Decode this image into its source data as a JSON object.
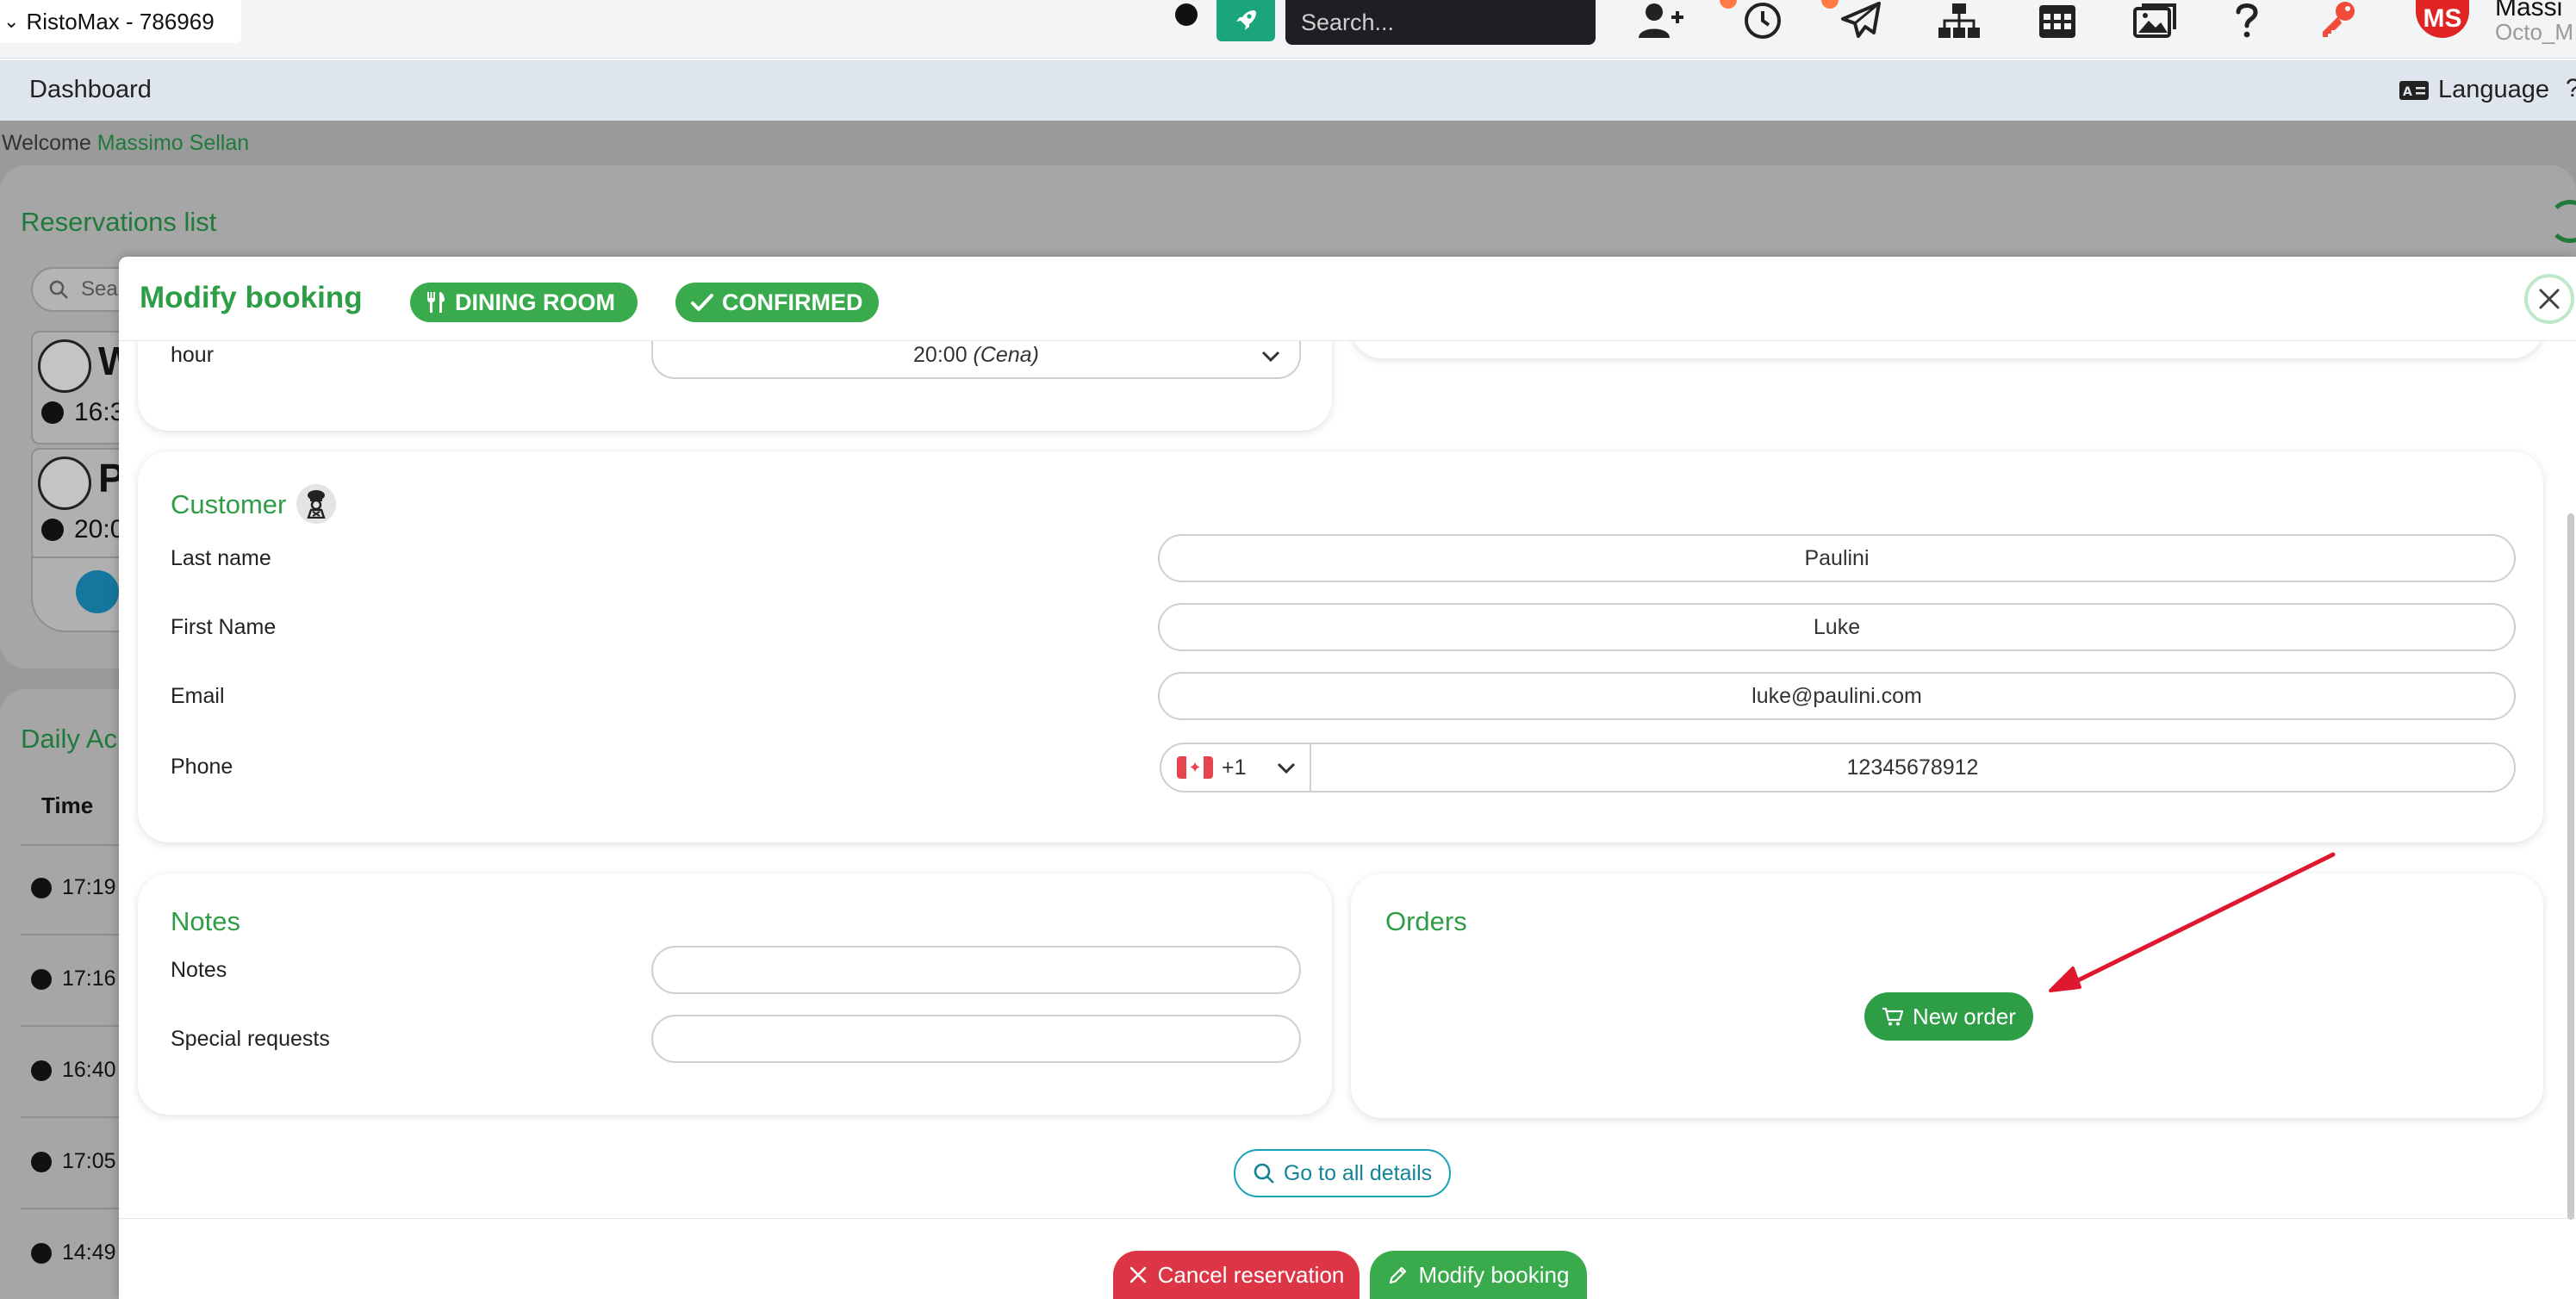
{
  "topbar": {
    "app_select": "RistoMax - 786969",
    "search_placeholder": "Search...",
    "user": {
      "initials": "MS",
      "name": "Massi",
      "sub": "Octo_M"
    }
  },
  "navbar": {
    "dashboard": "Dashboard",
    "language": "Language",
    "help": "?"
  },
  "background": {
    "welcome_prefix": "Welcome",
    "welcome_name": "Massimo Sellan",
    "reservations_title": "Reservations list",
    "search_placeholder": "Sea",
    "items": [
      {
        "letter": "W",
        "time": "16:3"
      },
      {
        "letter": "P",
        "time": "20:0"
      }
    ],
    "daily_title": "Daily Ac",
    "time_header": "Time",
    "times": [
      "17:19",
      "17:16",
      "16:40",
      "17:05",
      "14:49"
    ]
  },
  "modal": {
    "title": "Modify booking",
    "badges": {
      "dining_room": "DINING ROOM",
      "confirmed": "CONFIRMED"
    },
    "hour": {
      "label": "hour",
      "value": "20:00",
      "value_note": "(Cena)"
    },
    "customer": {
      "title": "Customer",
      "last_name_label": "Last name",
      "last_name": "Paulini",
      "first_name_label": "First Name",
      "first_name": "Luke",
      "email_label": "Email",
      "email": "luke@paulini.com",
      "phone_label": "Phone",
      "phone_prefix": "+1",
      "phone": "12345678912"
    },
    "notes": {
      "title": "Notes",
      "notes_label": "Notes",
      "notes_value": "",
      "special_label": "Special requests",
      "special_value": ""
    },
    "orders": {
      "title": "Orders",
      "new_order": "New order"
    },
    "details_button": "Go to all details",
    "footer": {
      "cancel": "Cancel reservation",
      "modify": "Modify booking"
    }
  },
  "colors": {
    "brand_green": "#2e9e46",
    "danger": "#dc3545",
    "info": "#17a2b8",
    "annotation_arrow": "#e0182f"
  }
}
